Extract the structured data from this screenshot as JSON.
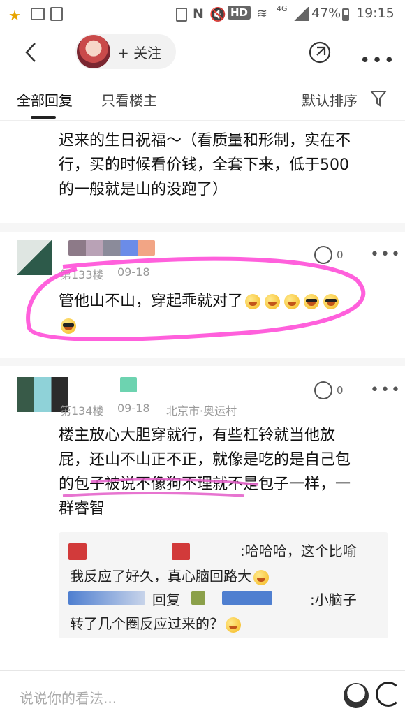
{
  "status": {
    "hd": "HD",
    "net": "4G",
    "battery": "47%",
    "time": "19:15"
  },
  "nav": {
    "follow": "+ 关注"
  },
  "tabs": {
    "all": "全部回复",
    "op_only": "只看楼主",
    "sort": "默认排序"
  },
  "post0": {
    "lines": [
      "迟来的生日祝福～（看质量和形制，实在不",
      "行，买的时候看价钱，全套下来，低于500",
      "的一般就是山的没跑了）"
    ]
  },
  "post1": {
    "floor": "第133楼",
    "date": "09-18",
    "likes": "0",
    "line1": "管他山不山，穿起乖就对了"
  },
  "post2": {
    "floor": "第134楼",
    "date": "09-18",
    "location": "北京市·奥运村",
    "likes": "0",
    "lines": [
      "楼主放心大胆穿就行，有些杠铃就当他放",
      "屁，还山不山正不正，就像是吃的是自己包",
      "的包子被说不像狗不理就不是包子一样，一",
      "群睿智"
    ],
    "reply1_a": ":哈哈哈，这个比喻",
    "reply1_b": "我反应了好久，真心脑回路大",
    "reply2_a": "回复",
    "reply2_b": ":小脑子",
    "reply2_c": "转了几个圈反应过来的？"
  },
  "comment_bar": {
    "placeholder": "说说你的看法..."
  }
}
